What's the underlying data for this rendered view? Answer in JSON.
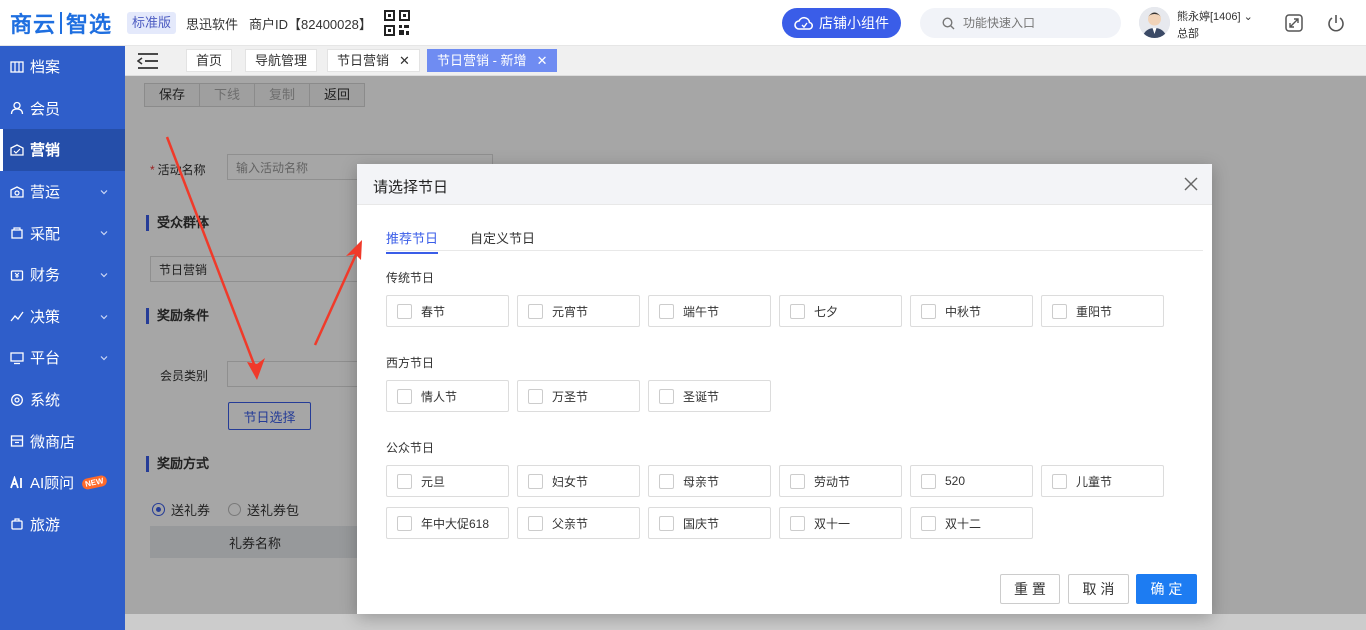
{
  "header": {
    "logo_left": "商云",
    "logo_right": "智选",
    "edition": "标准版",
    "company": "思迅软件",
    "merchant": "商户ID【82400028】",
    "widget_label": "店铺小组件",
    "search_placeholder": "功能快速入口",
    "user_name": "熊永婷[1406]",
    "user_dept": "总部",
    "icons": [
      "qr-code-icon",
      "cloud-icon",
      "search-icon",
      "expand-icon",
      "power-icon"
    ]
  },
  "sidebar": {
    "items": [
      {
        "label": "档案",
        "icon": "archive-icon"
      },
      {
        "label": "会员",
        "icon": "user-icon"
      },
      {
        "label": "营销",
        "icon": "marketing-icon"
      },
      {
        "label": "营运",
        "icon": "operation-icon"
      },
      {
        "label": "采配",
        "icon": "purchase-icon"
      },
      {
        "label": "财务",
        "icon": "finance-icon"
      },
      {
        "label": "决策",
        "icon": "decision-icon"
      },
      {
        "label": "平台",
        "icon": "platform-icon"
      },
      {
        "label": "系统",
        "icon": "system-icon"
      },
      {
        "label": "微商店",
        "icon": "shop-icon"
      },
      {
        "label": "AI顾问",
        "icon": "ai-icon"
      },
      {
        "label": "旅游",
        "icon": "travel-icon"
      }
    ],
    "new_badge": "NEW"
  },
  "tabs": [
    {
      "label": "首页"
    },
    {
      "label": "导航管理"
    },
    {
      "label": "节日营销"
    },
    {
      "label": "节日营销 - 新增"
    }
  ],
  "page": {
    "toolbar": [
      "保存",
      "下线",
      "复制",
      "返回"
    ],
    "activity_name_label": "活动名称",
    "activity_name_placeholder": "输入活动名称",
    "audience_title": "受众群体",
    "audience_value": "节日营销",
    "reward_cond_title": "奖励条件",
    "member_type_label": "会员类别",
    "holiday_pick_button": "节日选择",
    "reward_method_title": "奖励方式",
    "radio_coupon": "送礼券",
    "radio_coupon_pack": "送礼券包",
    "coupon_name_header": "礼券名称"
  },
  "modal": {
    "title": "请选择节日",
    "tabs": [
      "推荐节日",
      "自定义节日"
    ],
    "groups": [
      {
        "title": "传统节日",
        "items": [
          "春节",
          "元宵节",
          "端午节",
          "七夕",
          "中秋节",
          "重阳节"
        ]
      },
      {
        "title": "西方节日",
        "items": [
          "情人节",
          "万圣节",
          "圣诞节"
        ]
      },
      {
        "title": "公众节日",
        "items": [
          "元旦",
          "妇女节",
          "母亲节",
          "劳动节",
          "520",
          "儿童节",
          "年中大促618",
          "父亲节",
          "国庆节",
          "双十一",
          "双十二"
        ]
      }
    ],
    "buttons": {
      "reset": "重 置",
      "cancel": "取 消",
      "confirm": "确 定"
    }
  },
  "colors": {
    "sidebar_bg": "#2f5eca",
    "accent": "#3a5de8",
    "confirm": "#1d7cf2",
    "annotation_arrow": "#f03a2a"
  }
}
